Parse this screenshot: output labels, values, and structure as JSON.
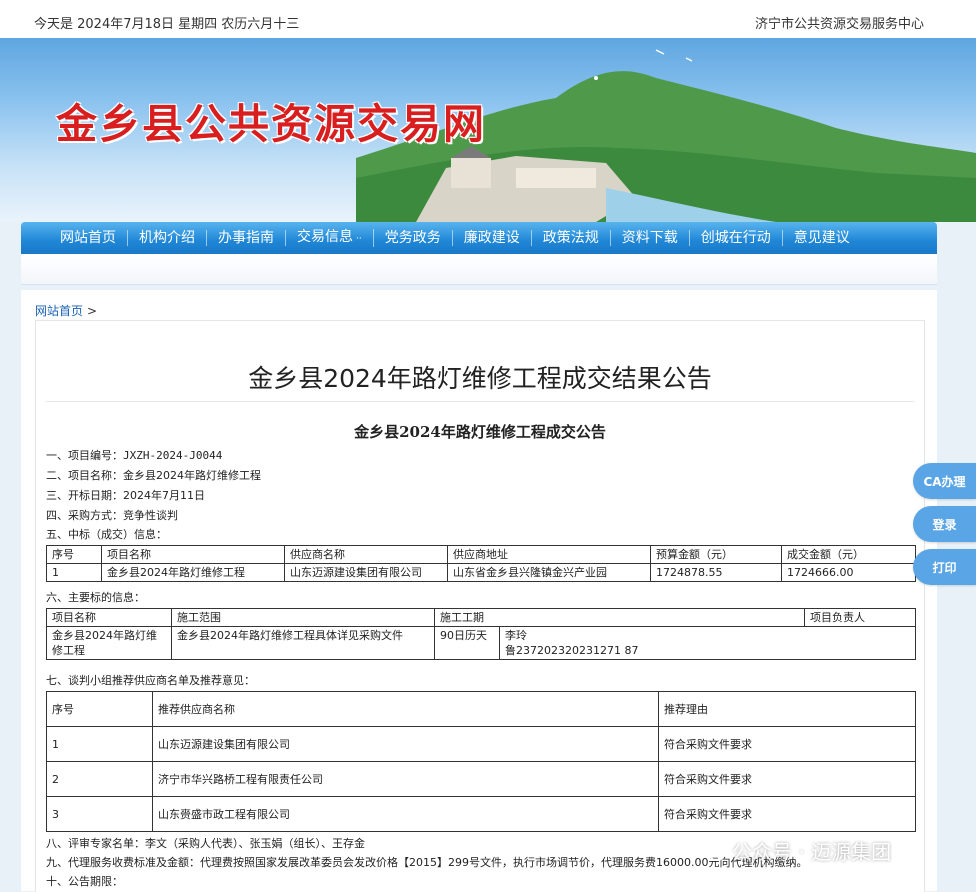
{
  "topbar": {
    "date": "今天是 2024年7月18日 星期四 农历六月十三",
    "center_name": "济宁市公共资源交易服务中心"
  },
  "banner": {
    "site_title": "金乡县公共资源交易网"
  },
  "nav": {
    "items": [
      "网站首页",
      "机构介绍",
      "办事指南",
      "交易信息",
      "党务政务",
      "廉政建设",
      "政策法规",
      "资料下载",
      "创城在行动",
      "意见建议"
    ],
    "dropdown_marker": "··"
  },
  "breadcrumb": {
    "home": "网站首页",
    "sep": ">"
  },
  "article": {
    "title": "金乡县2024年路灯维修工程成交结果公告",
    "subtitle": "金乡县2024年路灯维修工程成交公告",
    "line1_label": "一、项目编号：",
    "line1_value": "JXZH-2024-J0044",
    "line2": "二、项目名称：金乡县2024年路灯维修工程",
    "line3": "三、开标日期：2024年7月11日",
    "line4": "四、采购方式：竞争性谈判",
    "line5": "五、中标（成交）信息：",
    "table1": {
      "headers": [
        "序号",
        "项目名称",
        "供应商名称",
        "供应商地址",
        "预算金额（元）",
        "成交金额（元）"
      ],
      "row": [
        "1",
        "金乡县2024年路灯维修工程",
        "山东迈源建设集团有限公司",
        "山东省金乡县兴隆镇金兴产业园",
        "1724878.55",
        "1724666.00"
      ]
    },
    "line6": "六、主要标的信息：",
    "table2": {
      "headers": [
        "项目名称",
        "施工范围",
        "施工工期",
        "项目负责人"
      ],
      "project_name": "金乡县2024年路灯维修工程",
      "scope": "金乡县2024年路灯维修工程具体详见采购文件",
      "period": "90日历天",
      "manager": "李玲",
      "cert": "鲁237202320231271 87"
    },
    "line7": "七、谈判小组推荐供应商名单及推荐意见：",
    "table3": {
      "headers": [
        "序号",
        "推荐供应商名称",
        "推荐理由"
      ],
      "rows": [
        [
          "1",
          "山东迈源建设集团有限公司",
          "符合采购文件要求"
        ],
        [
          "2",
          "济宁市华兴路桥工程有限责任公司",
          "符合采购文件要求"
        ],
        [
          "3",
          "山东赍盛市政工程有限公司",
          "符合采购文件要求"
        ]
      ]
    },
    "line8": "八、评审专家名单：李文（采购人代表）、张玉娟（组长）、王存金",
    "line9": "九、代理服务收费标准及金额：代理费按照国家发展改革委员会发改价格【2015】299号文件，执行市场调节价，代理服务费16000.00元向代理机构缴纳。",
    "line10": "十、公告期限："
  },
  "side_buttons": [
    "CA办理",
    "登录",
    "打印"
  ],
  "watermark": "公众号 · 迈源集团",
  "colors": {
    "nav": "#1f86d6",
    "title_red": "#d81e1e",
    "side_button": "#5aa5e6",
    "link": "#1a62b3"
  }
}
